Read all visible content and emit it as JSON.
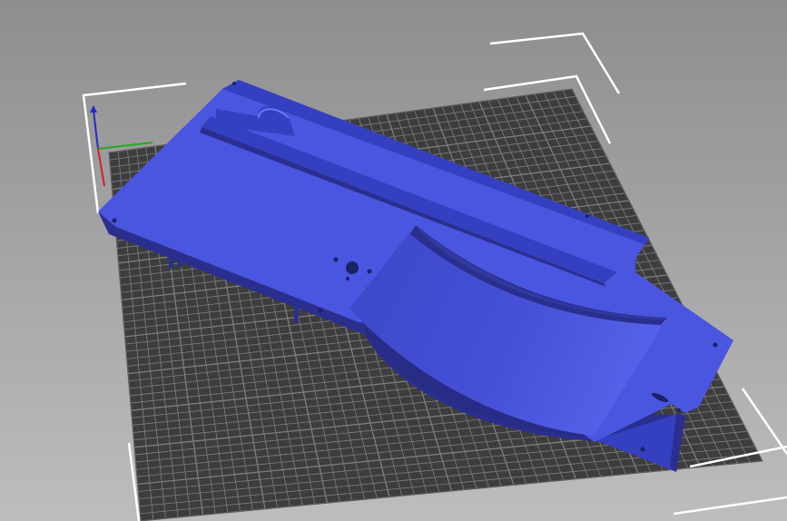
{
  "viewport": {
    "background_top": "#8e8e8e",
    "background_bottom": "#bdbdbd"
  },
  "bed": {
    "surface_color": "#3d3d3d",
    "grid_color": "#8a8a8a",
    "boundary_color": "#ffffff"
  },
  "axes": {
    "x_color": "#d42020",
    "y_color": "#1faa1f",
    "z_color": "#2828c8"
  },
  "model": {
    "color": "#4a55e0",
    "shade_color": "#3540c0",
    "dark_color": "#2a2f8f",
    "hole_color": "#1d2266"
  },
  "icons": [
    "axis-gizmo-icon"
  ]
}
